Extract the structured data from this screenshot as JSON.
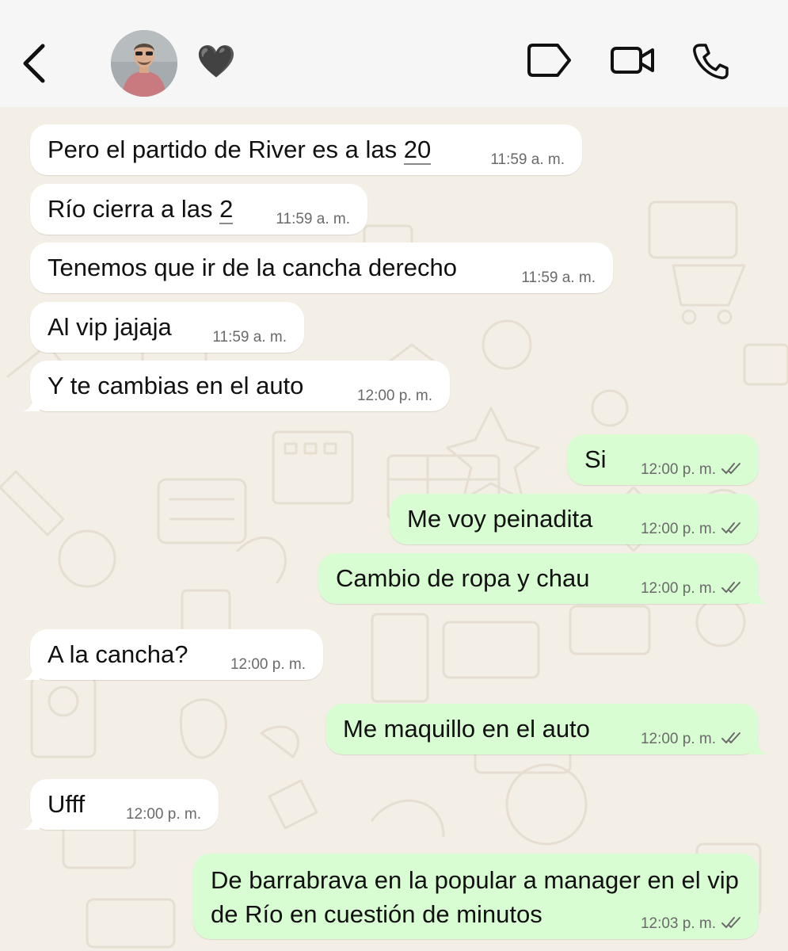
{
  "header": {
    "contact_name": "🖤",
    "icons": [
      "back-chevron-icon",
      "avatar",
      "label-tag-icon",
      "video-camera-icon",
      "phone-icon"
    ]
  },
  "colors": {
    "incoming_bubble": "#ffffff",
    "outgoing_bubble": "#d9fdd3",
    "chat_background": "#f3eee6",
    "header_background": "#f6f6f6",
    "read_ticks": "#6a6a6a"
  },
  "messages": [
    {
      "dir": "in",
      "text_before": "Pero el partido de River es a las ",
      "text_link": "20",
      "time": "11:59 a. m."
    },
    {
      "dir": "in",
      "text_before": "Río cierra a las ",
      "text_link": "2",
      "time": "11:59 a. m."
    },
    {
      "dir": "in",
      "text": "Tenemos que ir de la cancha derecho",
      "time": "11:59 a. m."
    },
    {
      "dir": "in",
      "text": "Al vip jajaja",
      "time": "11:59 a. m."
    },
    {
      "dir": "in",
      "text": "Y te cambias en el auto",
      "time": "12:00 p. m."
    },
    {
      "dir": "out",
      "text": "Si",
      "time": "12:00 p. m."
    },
    {
      "dir": "out",
      "text": "Me voy peinadita",
      "time": "12:00 p. m."
    },
    {
      "dir": "out",
      "text": "Cambio de ropa y chau",
      "time": "12:00 p. m."
    },
    {
      "dir": "in",
      "text": "A la cancha?",
      "time": "12:00 p. m."
    },
    {
      "dir": "out",
      "text": "Me maquillo en el auto",
      "time": "12:00 p. m."
    },
    {
      "dir": "in",
      "text": "Ufff",
      "time": "12:00 p. m."
    },
    {
      "dir": "out",
      "text": "De barrabrava en la popular a manager en el vip de Río en cuestión de minutos",
      "time": "12:03 p. m."
    }
  ]
}
